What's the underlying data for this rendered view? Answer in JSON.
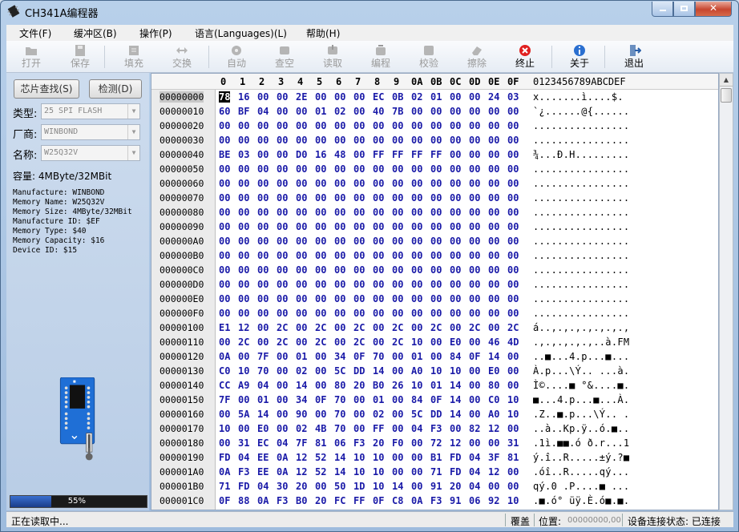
{
  "window": {
    "title": "CH341A编程器"
  },
  "menu": [
    "文件(F)",
    "缓冲区(B)",
    "操作(P)",
    "语言(Languages)(L)",
    "帮助(H)"
  ],
  "toolbar": [
    {
      "label": "打开",
      "icon": "open-icon",
      "enabled": false
    },
    {
      "label": "保存",
      "icon": "save-icon",
      "enabled": false
    },
    {
      "label": "填充",
      "icon": "fill-icon",
      "enabled": false
    },
    {
      "label": "交换",
      "icon": "swap-icon",
      "enabled": false
    },
    {
      "label": "自动",
      "icon": "auto-icon",
      "enabled": false
    },
    {
      "label": "查空",
      "icon": "blank-check-icon",
      "enabled": false
    },
    {
      "label": "读取",
      "icon": "read-icon",
      "enabled": false
    },
    {
      "label": "编程",
      "icon": "program-icon",
      "enabled": false
    },
    {
      "label": "校验",
      "icon": "verify-icon",
      "enabled": false
    },
    {
      "label": "擦除",
      "icon": "erase-icon",
      "enabled": false
    },
    {
      "label": "终止",
      "icon": "stop-icon",
      "enabled": true
    },
    {
      "label": "关于",
      "icon": "info-icon",
      "enabled": true
    },
    {
      "label": "退出",
      "icon": "exit-icon",
      "enabled": true
    }
  ],
  "left": {
    "find_chip": "芯片查找(S)",
    "detect": "检测(D)",
    "type_label": "类型:",
    "type_value": "25 SPI FLASH",
    "vendor_label": "厂商:",
    "vendor_value": "WINBOND",
    "name_label": "名称:",
    "name_value": "W25Q32V",
    "capacity": "容量: 4MByte/32MBit",
    "info": [
      "Manufacture: WINBOND",
      "Memory Name: W25Q32V",
      "Memory Size: 4MByte/32MBit",
      "Manufacture ID: $EF",
      "Memory Type: $40",
      "Memory Capacity: $16",
      "Device ID: $15"
    ],
    "progress_percent": 55,
    "progress_text": "55%"
  },
  "hex": {
    "columns": [
      "0",
      "1",
      "2",
      "3",
      "4",
      "5",
      "6",
      "7",
      "8",
      "9",
      "0A",
      "0B",
      "0C",
      "0D",
      "0E",
      "0F"
    ],
    "ascii_header": "0123456789ABCDEF",
    "rows": [
      {
        "addr": "00000000",
        "bytes": "78 16 00 00 2E 00 00 00 EC 0B 02 01 00 00 24 03",
        "ascii": "x.......ì....$."
      },
      {
        "addr": "00000010",
        "bytes": "60 BF 04 00 00 01 02 00 40 7B 00 00 00 00 00 00",
        "ascii": "`¿......@{......"
      },
      {
        "addr": "00000020",
        "bytes": "00 00 00 00 00 00 00 00 00 00 00 00 00 00 00 00",
        "ascii": "................"
      },
      {
        "addr": "00000030",
        "bytes": "00 00 00 00 00 00 00 00 00 00 00 00 00 00 00 00",
        "ascii": "................"
      },
      {
        "addr": "00000040",
        "bytes": "BE 03 00 00 D0 16 48 00 FF FF FF FF 00 00 00 00",
        "ascii": "¾...Ð.H........."
      },
      {
        "addr": "00000050",
        "bytes": "00 00 00 00 00 00 00 00 00 00 00 00 00 00 00 00",
        "ascii": "................"
      },
      {
        "addr": "00000060",
        "bytes": "00 00 00 00 00 00 00 00 00 00 00 00 00 00 00 00",
        "ascii": "................"
      },
      {
        "addr": "00000070",
        "bytes": "00 00 00 00 00 00 00 00 00 00 00 00 00 00 00 00",
        "ascii": "................"
      },
      {
        "addr": "00000080",
        "bytes": "00 00 00 00 00 00 00 00 00 00 00 00 00 00 00 00",
        "ascii": "................"
      },
      {
        "addr": "00000090",
        "bytes": "00 00 00 00 00 00 00 00 00 00 00 00 00 00 00 00",
        "ascii": "................"
      },
      {
        "addr": "000000A0",
        "bytes": "00 00 00 00 00 00 00 00 00 00 00 00 00 00 00 00",
        "ascii": "................"
      },
      {
        "addr": "000000B0",
        "bytes": "00 00 00 00 00 00 00 00 00 00 00 00 00 00 00 00",
        "ascii": "................"
      },
      {
        "addr": "000000C0",
        "bytes": "00 00 00 00 00 00 00 00 00 00 00 00 00 00 00 00",
        "ascii": "................"
      },
      {
        "addr": "000000D0",
        "bytes": "00 00 00 00 00 00 00 00 00 00 00 00 00 00 00 00",
        "ascii": "................"
      },
      {
        "addr": "000000E0",
        "bytes": "00 00 00 00 00 00 00 00 00 00 00 00 00 00 00 00",
        "ascii": "................"
      },
      {
        "addr": "000000F0",
        "bytes": "00 00 00 00 00 00 00 00 00 00 00 00 00 00 00 00",
        "ascii": "................"
      },
      {
        "addr": "00000100",
        "bytes": "E1 12 00 2C 00 2C 00 2C 00 2C 00 2C 00 2C 00 2C",
        "ascii": "á..,.,.,.,.,.,.,"
      },
      {
        "addr": "00000110",
        "bytes": "00 2C 00 2C 00 2C 00 2C 00 2C 10 00 E0 00 46 4D",
        "ascii": ".,.,.,.,.,..à.FM"
      },
      {
        "addr": "00000120",
        "bytes": "0A 00 7F 00 01 00 34 0F 70 00 01 00 84 0F 14 00",
        "ascii": "..■...4.p...■..."
      },
      {
        "addr": "00000130",
        "bytes": "C0 10 70 00 02 00 5C DD 14 00 A0 10 10 00 E0 00",
        "ascii": "À.p...\\Ý.. ...à."
      },
      {
        "addr": "00000140",
        "bytes": "CC A9 04 00 14 00 80 20 B0 26 10 01 14 00 80 00",
        "ascii": "Ì©....■ °&....■."
      },
      {
        "addr": "00000150",
        "bytes": "7F 00 01 00 34 0F 70 00 01 00 84 0F 14 00 C0 10",
        "ascii": "■...4.p...■...À."
      },
      {
        "addr": "00000160",
        "bytes": "00 5A 14 00 90 00 70 00 02 00 5C DD 14 00 A0 10",
        "ascii": ".Z..■.p...\\Ý.. ."
      },
      {
        "addr": "00000170",
        "bytes": "10 00 E0 00 02 4B 70 00 FF 00 04 F3 00 82 12 00",
        "ascii": "..à..Kp.ÿ..ó.■.."
      },
      {
        "addr": "00000180",
        "bytes": "00 31 EC 04 7F 81 06 F3 20 F0 00 72 12 00 00 31",
        "ascii": ".1ì.■■.ó ð.r...1"
      },
      {
        "addr": "00000190",
        "bytes": "FD 04 EE 0A 12 52 14 10 10 00 00 B1 FD 04 3F 81",
        "ascii": "ý.î..R.....±ý.?■"
      },
      {
        "addr": "000001A0",
        "bytes": "0A F3 EE 0A 12 52 14 10 10 00 00 71 FD 04 12 00",
        "ascii": ".óî..R.....qý..."
      },
      {
        "addr": "000001B0",
        "bytes": "71 FD 04 30 20 00 50 1D 10 14 00 91 20 04 00 00",
        "ascii": "qý.0 .P....■ ..."
      },
      {
        "addr": "000001C0",
        "bytes": "0F 88 0A F3 B0 20 FC FF 0F C8 0A F3 91 06 92 10",
        "ascii": ".■.ó° üÿ.È.ó■.■."
      }
    ]
  },
  "status": {
    "message": "正在读取中...",
    "mode": "覆盖",
    "position_label": "位置:",
    "position_value": "00000000,00",
    "device_status": "设备连接状态: 已连接"
  }
}
